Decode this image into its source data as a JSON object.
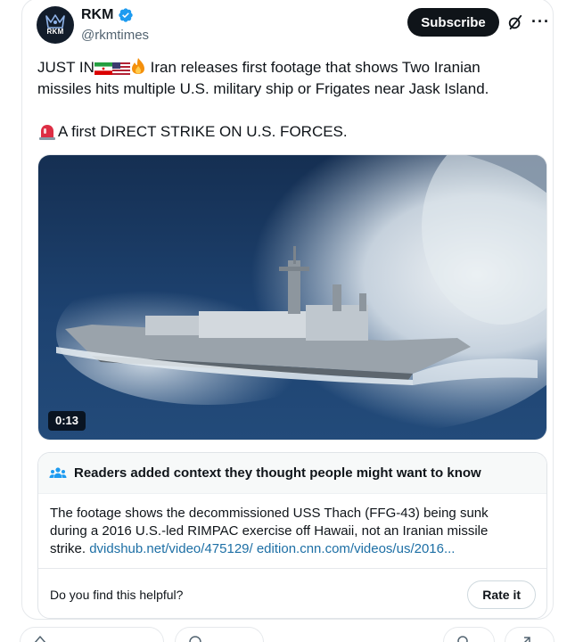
{
  "author": {
    "display_name": "RKM",
    "handle": "@rkmtimes",
    "avatar_text": "RKM",
    "verified": true
  },
  "header": {
    "subscribe_label": "Subscribe",
    "more_label": "···"
  },
  "post": {
    "line1_prefix": "JUST IN",
    "line1_rest": "Iran releases first footage that shows Two Iranian",
    "line2": "missiles hits multiple U.S. military ship or Frigates near Jask Island.",
    "line3": "A first DIRECT STRIKE ON U.S. FORCES."
  },
  "media": {
    "duration": "0:13"
  },
  "community_note": {
    "header": "Readers added context they thought people might want to know",
    "body_line1": "The footage shows the decommissioned USS Thach (FFG-43) being sunk",
    "body_line2": "during a 2016 U.S.-led RIMPAC exercise off Hawaii, not an Iranian missile",
    "body_line3_prefix": "strike.",
    "link1": "dvidshub.net/video/475129/",
    "link2": "edition.cnn.com/videos/us/2016...",
    "helpful_question": "Do you find this helpful?",
    "rate_label": "Rate it"
  },
  "colors": {
    "accent": "#1d9bf0",
    "subscribe_bg": "#0f1419",
    "link": "#1d6fa5",
    "secondary_text": "#536471"
  }
}
